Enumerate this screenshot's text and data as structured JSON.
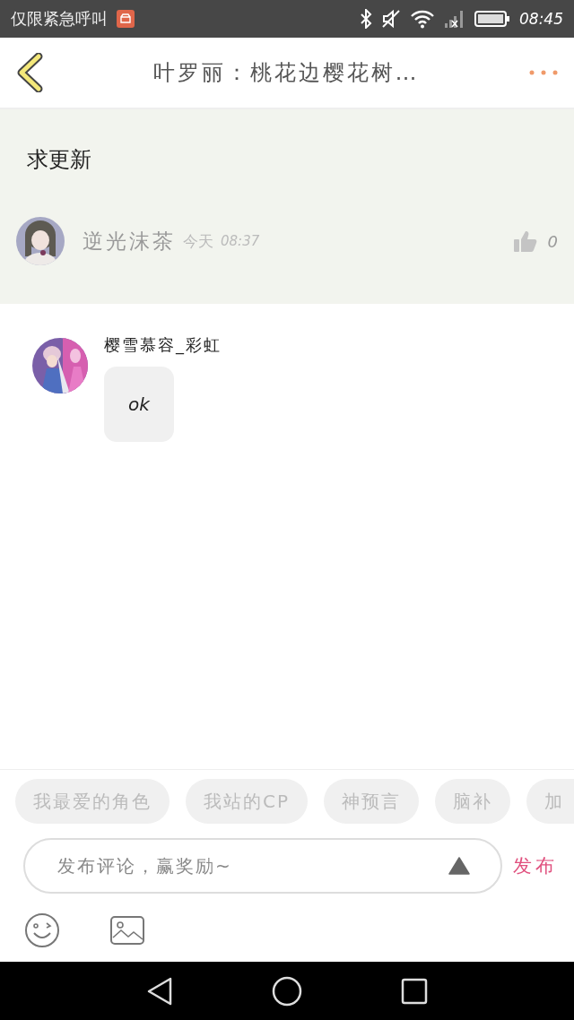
{
  "status_bar": {
    "carrier": "仅限紧急呼叫",
    "time": "08:45"
  },
  "header": {
    "title": "叶罗丽：桃花边樱花树…"
  },
  "post": {
    "title": "求更新",
    "author": "逆光沫茶",
    "date": "今天",
    "time": "08:37",
    "likes": "0"
  },
  "comments": [
    {
      "author": "樱雪慕容_彩虹",
      "text": "ok"
    }
  ],
  "tags": [
    "我最爱的角色",
    "我站的CP",
    "神预言",
    "脑补",
    "加"
  ],
  "composer": {
    "placeholder": "发布评论，赢奖励~",
    "send": "发布"
  }
}
